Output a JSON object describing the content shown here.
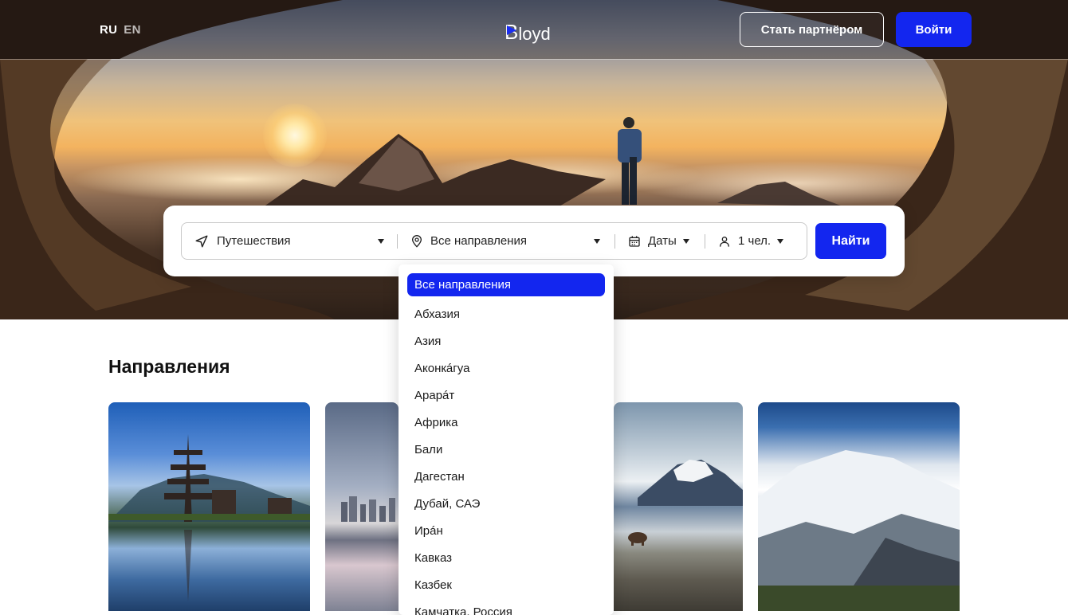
{
  "header": {
    "lang_ru": "RU",
    "lang_en": "EN",
    "logo_text": "loyd",
    "logo_letter": "B",
    "partner_button": "Стать партнёром",
    "login_button": "Войти"
  },
  "search": {
    "travel_type": "Путешествия",
    "destination": "Все направления",
    "dates": "Даты",
    "people": "1 чел.",
    "find_button": "Найти"
  },
  "section": {
    "title": "Направления"
  },
  "dropdown": {
    "items": [
      "Все направления",
      "Абхазия",
      "Азия",
      "Аконкáгуа",
      "Арарáт",
      "Африка",
      "Бали",
      "Дагестан",
      "Дубай, САЭ",
      "Ирáн",
      "Кавказ",
      "Казбек",
      "Камчатка, Россия"
    ],
    "selected_index": 0
  },
  "colors": {
    "accent": "#1326ef",
    "text": "#111111"
  }
}
